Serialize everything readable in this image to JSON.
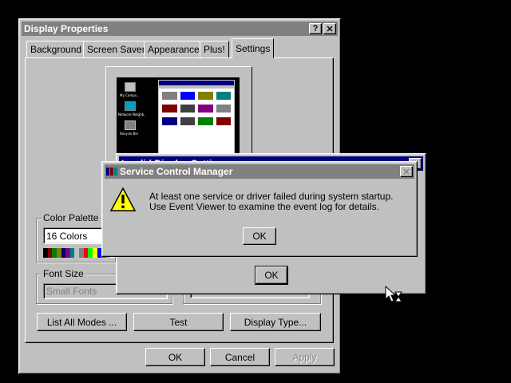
{
  "display_properties": {
    "title": "Display Properties",
    "help_btn": "?",
    "close_btn": "✕",
    "tabs": [
      "Background",
      "Screen Saver",
      "Appearance",
      "Plus!",
      "Settings"
    ],
    "color_palette": {
      "label": "Color Palette",
      "value": "16 Colors"
    },
    "font_size": {
      "label": "Font Size",
      "value": "Small Fonts"
    },
    "buttons": {
      "list_all_modes": "List All Modes ...",
      "test": "Test",
      "display_type": "Display Type...",
      "ok": "OK",
      "cancel": "Cancel",
      "apply": "Apply"
    },
    "palette_colors": [
      "#000000",
      "#800000",
      "#008000",
      "#808000",
      "#000080",
      "#800080",
      "#008080",
      "#c0c0c0",
      "#808080",
      "#ff0000",
      "#00ff00",
      "#ffff00",
      "#0000ff",
      "#ff00ff",
      "#00ffff",
      "#ffffff"
    ]
  },
  "invalid_settings": {
    "title": "Invalid Display Settings",
    "close_btn": "✕",
    "ok_label": "OK"
  },
  "service_control_manager": {
    "title": "Service Control Manager",
    "close_btn": "✕",
    "message": "At least one service or driver failed during system startup.  Use Event Viewer to examine the event log for details.",
    "ok_label": "OK",
    "icon": "warning-icon"
  },
  "monitor_preview": {
    "desktop_icons": [
      "My Compu..",
      "Network Neighb..",
      "Recycle Bin"
    ]
  },
  "colors": {
    "active_title": "#000080",
    "inactive_title": "#808080",
    "face": "#c0c0c0",
    "desktop": "#000000"
  }
}
